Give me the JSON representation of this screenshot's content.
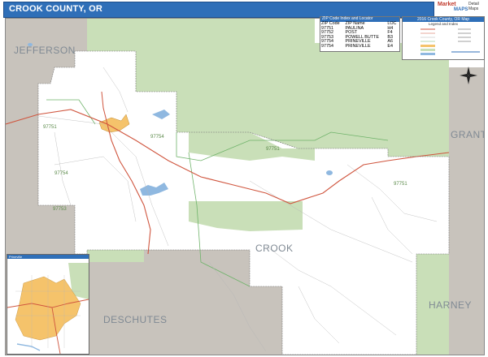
{
  "title": "CROOK COUNTY, OR",
  "logo": {
    "line1": "Market",
    "line2": "MAPS",
    "line3": "Detail Maps"
  },
  "regions": [
    {
      "name": "JEFFERSON"
    },
    {
      "name": "GRANT"
    },
    {
      "name": "CROOK"
    },
    {
      "name": "DESCHUTES"
    },
    {
      "name": "HARNEY"
    }
  ],
  "zip_labels": [
    "97751",
    "97754",
    "97751",
    "97751",
    "97754",
    "97753"
  ],
  "zip_legend": {
    "header": "ZIP Code Index and Locator",
    "columns": [
      "ZIP Code",
      "ZIP Name",
      "LOC"
    ],
    "rows": [
      [
        "97751",
        "PAULINA",
        "H4"
      ],
      [
        "97752",
        "POST",
        "F4"
      ],
      [
        "97753",
        "POWELL BUTTE",
        "B3"
      ],
      [
        "97754",
        "PRINEVILLE",
        "A6"
      ],
      [
        "97754",
        "PRINEVILLE",
        "E4"
      ]
    ]
  },
  "map_key": {
    "header": "2016 Crook County, OR Map",
    "subheader": "Legend and Index"
  },
  "inset": {
    "header": "Prineville"
  },
  "colors": {
    "title_bar": "#2f6fb8",
    "forest": "#c9dfb8",
    "county_gray": "#c8c3bc",
    "highway": "#d0563f",
    "city": "#f5c36b",
    "water": "#8fb8e0",
    "zip_border": "#6fb36a"
  },
  "icons": [
    "north-arrow-icon"
  ]
}
